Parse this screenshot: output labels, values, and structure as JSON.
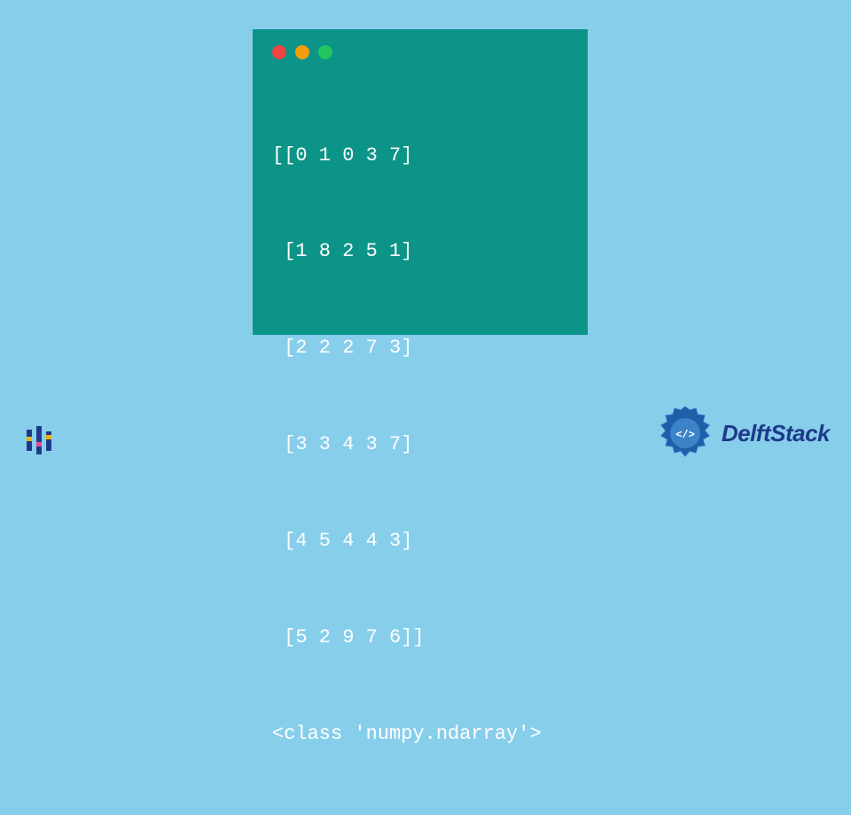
{
  "terminal": {
    "output_lines": [
      "[[0 1 0 3 7]",
      " [1 8 2 5 1]",
      " [2 2 2 7 3]",
      " [3 3 4 3 7]",
      " [4 5 4 4 3]",
      " [5 2 9 7 6]]",
      "<class 'numpy.ndarray'>"
    ]
  },
  "branding": {
    "name": "DelftStack"
  },
  "colors": {
    "background": "#87ceeb",
    "terminal_bg": "#0d9488",
    "text": "#ffffff",
    "brand_blue": "#1e3a8a"
  }
}
